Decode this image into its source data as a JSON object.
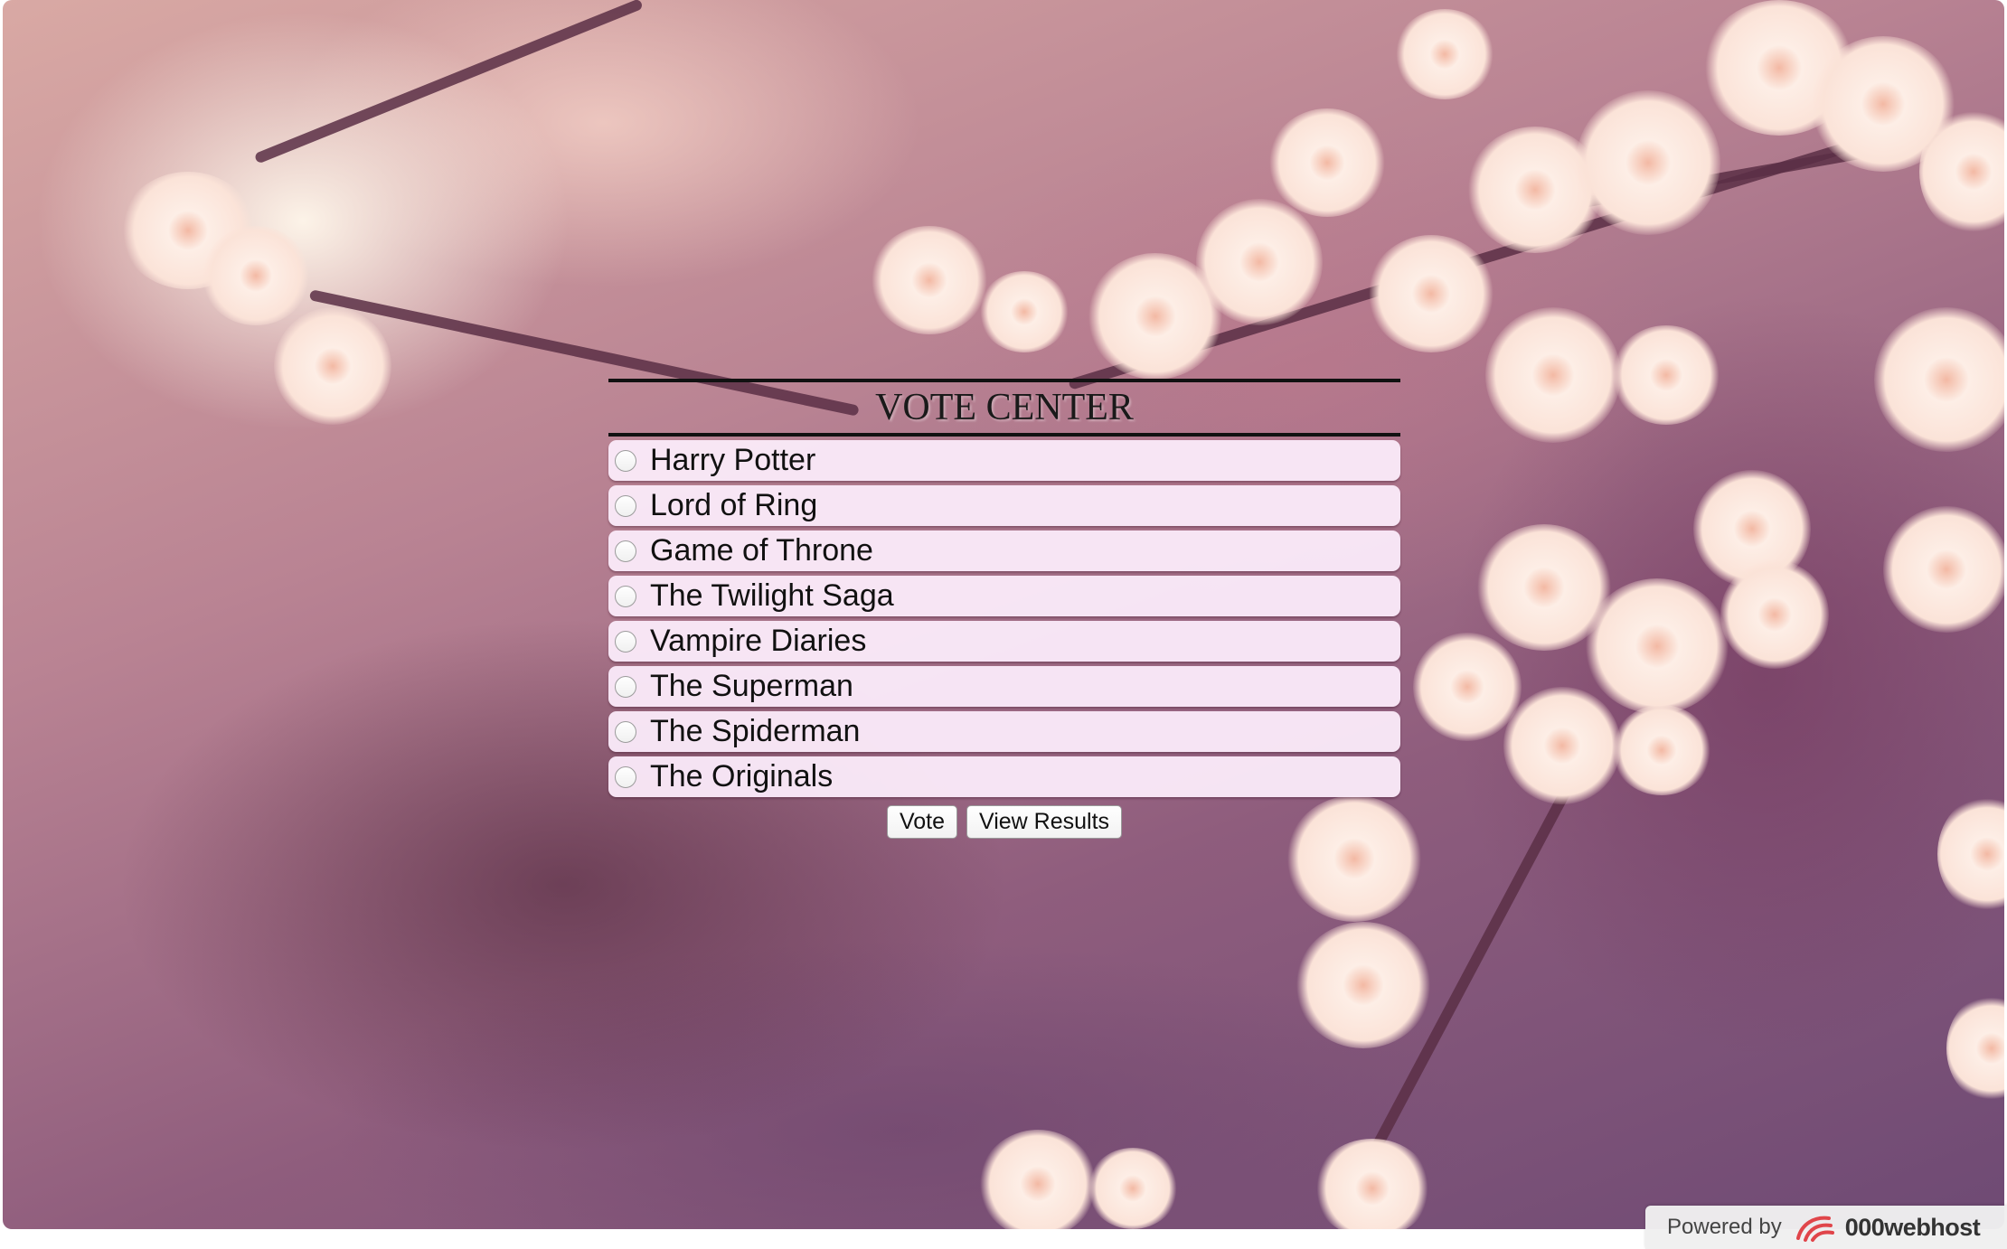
{
  "page": {
    "title": "VOTE CENTER"
  },
  "options": [
    {
      "label": "Harry Potter",
      "selected": false
    },
    {
      "label": "Lord of Ring",
      "selected": false
    },
    {
      "label": "Game of Throne",
      "selected": false
    },
    {
      "label": "The Twilight Saga",
      "selected": false
    },
    {
      "label": "Vampire Diaries",
      "selected": false
    },
    {
      "label": "The Superman",
      "selected": false
    },
    {
      "label": "The Spiderman",
      "selected": false
    },
    {
      "label": "The Originals",
      "selected": false
    }
  ],
  "buttons": {
    "vote_label": "Vote",
    "results_label": "View Results"
  },
  "footer": {
    "powered_by": "Powered by",
    "host_name": "000webhost",
    "host_icon": "000webhost-logo-icon"
  },
  "colors": {
    "option_background": "#fbebfa",
    "rule": "#111111",
    "background_tone": "#b98393"
  }
}
